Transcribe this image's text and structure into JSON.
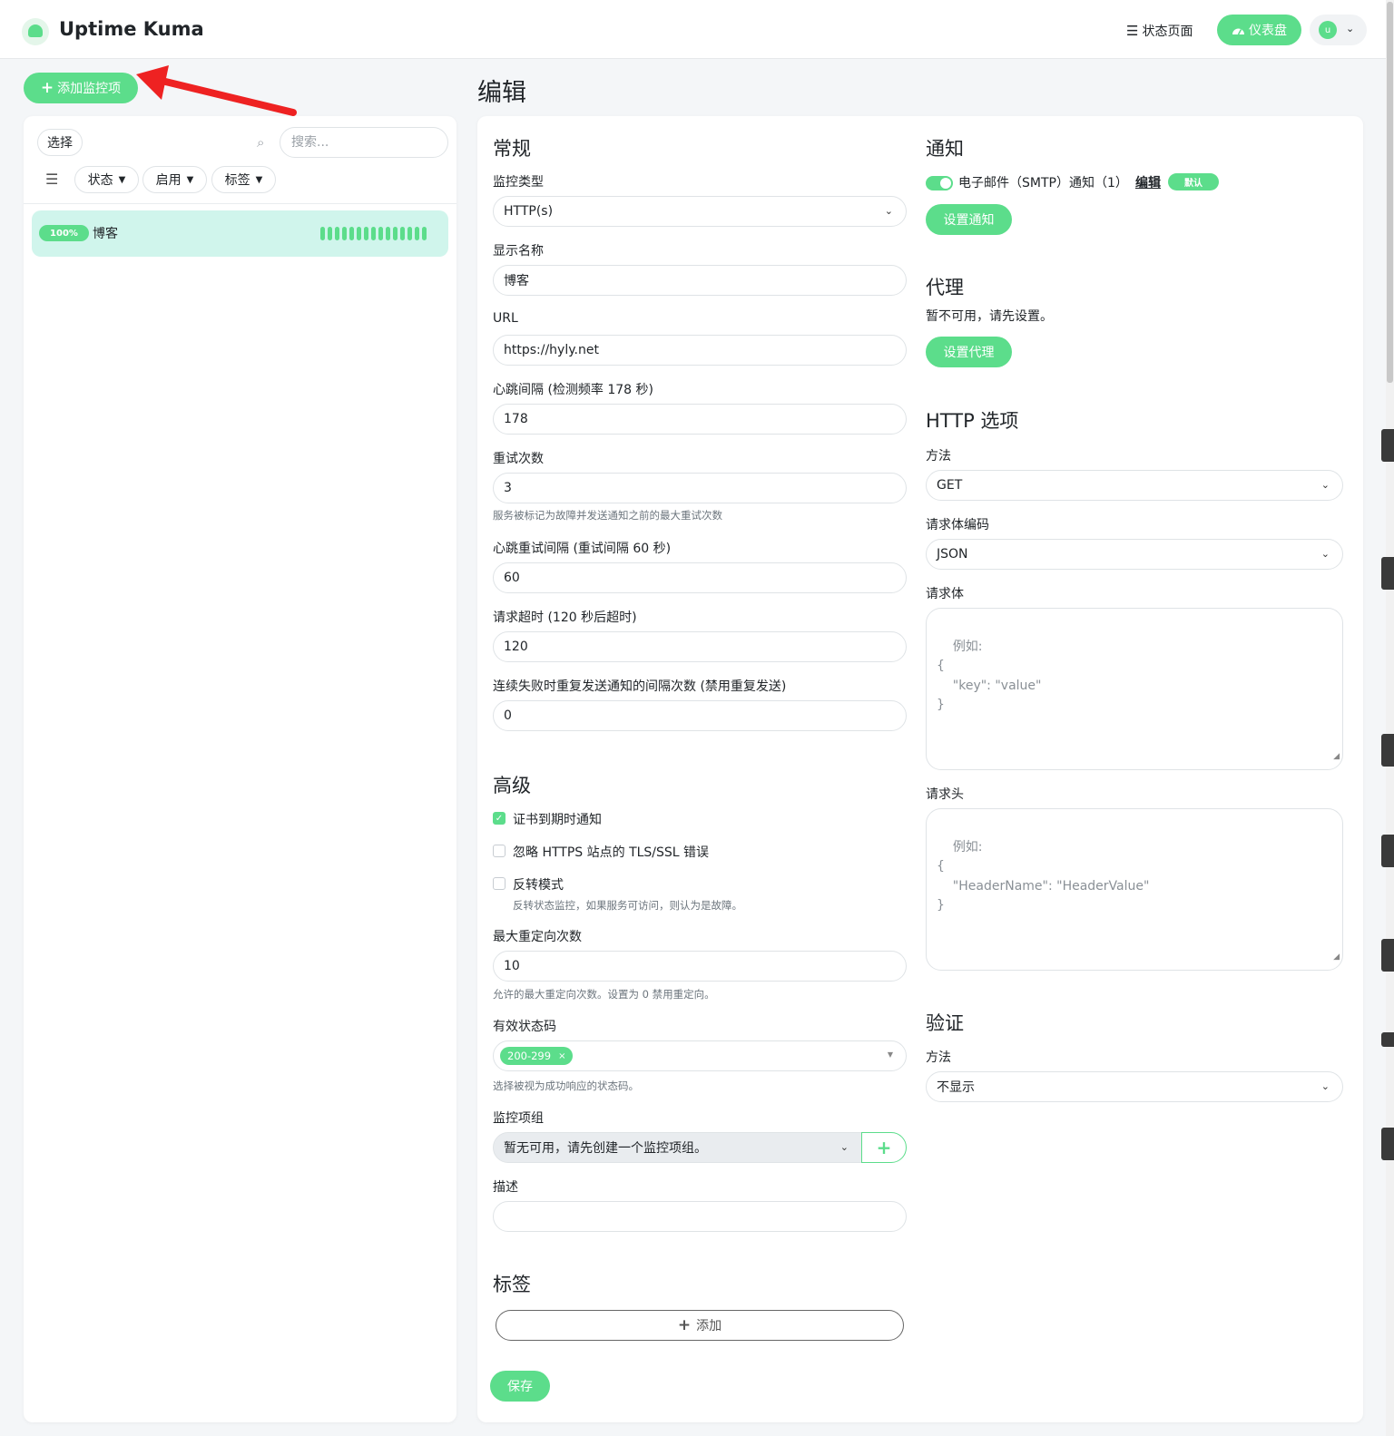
{
  "header": {
    "app_title": "Uptime Kuma",
    "status_page_label": "状态页面",
    "dashboard_label": "仪表盘",
    "avatar_initial": "u",
    "colors": {
      "accent": "#5cdd8b"
    }
  },
  "sidebar": {
    "add_monitor_label": "添加监控项",
    "select_label": "选择",
    "search_placeholder": "搜索...",
    "filters": [
      "状态",
      "启用",
      "标签"
    ],
    "monitors": [
      {
        "name": "博客",
        "uptime": "100%"
      }
    ]
  },
  "page": {
    "title": "编辑"
  },
  "general": {
    "title": "常规",
    "monitor_type_label": "监控类型",
    "monitor_type_value": "HTTP(s)",
    "display_name_label": "显示名称",
    "display_name_value": "博客",
    "url_label": "URL",
    "url_value": "https://hyly.net",
    "interval_label": "心跳间隔 (检测频率 178 秒)",
    "interval_value": "178",
    "retries_label": "重试次数",
    "retries_value": "3",
    "retries_hint": "服务被标记为故障并发送通知之前的最大重试次数",
    "retry_interval_label": "心跳重试间隔 (重试间隔 60 秒)",
    "retry_interval_value": "60",
    "timeout_label": "请求超时 (120 秒后超时)",
    "timeout_value": "120",
    "resend_label": "连续失败时重复发送通知的间隔次数 (禁用重复发送)",
    "resend_value": "0"
  },
  "advanced": {
    "title": "高级",
    "cert_expiry_label": "证书到期时通知",
    "cert_expiry_checked": true,
    "ignore_tls_label": "忽略 HTTPS 站点的 TLS/SSL 错误",
    "ignore_tls_checked": false,
    "upside_down_label": "反转模式",
    "upside_down_checked": false,
    "upside_down_hint": "反转状态监控，如果服务可访问，则认为是故障。",
    "max_redirects_label": "最大重定向次数",
    "max_redirects_value": "10",
    "max_redirects_hint": "允许的最大重定向次数。设置为 0 禁用重定向。",
    "accepted_codes_label": "有效状态码",
    "accepted_codes_tag": "200-299",
    "accepted_codes_hint": "选择被视为成功响应的状态码。",
    "group_label": "监控项组",
    "group_value": "暂无可用，请先创建一个监控项组。",
    "description_label": "描述",
    "description_value": ""
  },
  "tags": {
    "title": "标签",
    "add_label": "添加"
  },
  "save_label": "保存",
  "notifications": {
    "title": "通知",
    "item_label": "电子邮件（SMTP）通知（1）",
    "item_enabled": true,
    "edit_label": "编辑",
    "default_badge": "默认",
    "setup_label": "设置通知"
  },
  "proxy": {
    "title": "代理",
    "unavailable_text": "暂不可用，请先设置。",
    "setup_label": "设置代理"
  },
  "http_options": {
    "title": "HTTP 选项",
    "method_label": "方法",
    "method_value": "GET",
    "body_encoding_label": "请求体编码",
    "body_encoding_value": "JSON",
    "body_label": "请求体",
    "body_placeholder": "例如:\n{\n    \"key\": \"value\"\n}",
    "headers_label": "请求头",
    "headers_placeholder": "例如:\n{\n    \"HeaderName\": \"HeaderValue\"\n}"
  },
  "auth": {
    "title": "验证",
    "method_label": "方法",
    "method_value": "不显示"
  }
}
